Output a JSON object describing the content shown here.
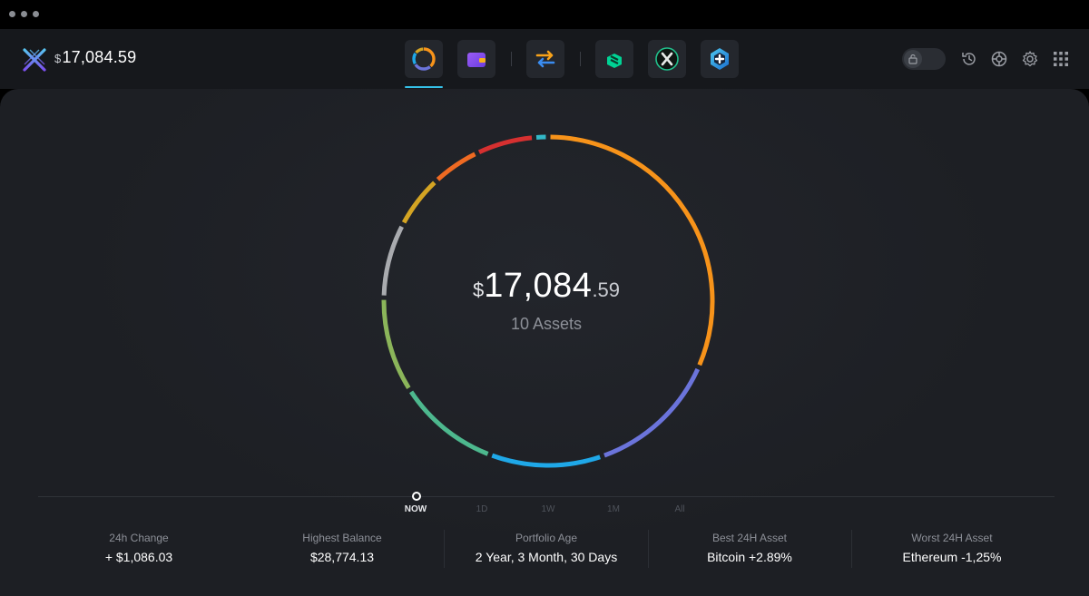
{
  "header": {
    "currency_symbol": "$",
    "balance": "17,084.59",
    "nav": [
      {
        "name": "portfolio",
        "active": true
      },
      {
        "name": "wallet"
      },
      {
        "name": "exchange"
      },
      {
        "name": "compound-app"
      },
      {
        "name": "x-app"
      },
      {
        "name": "add-app"
      }
    ],
    "tools": [
      "lock-toggle",
      "history-icon",
      "help-icon",
      "settings-icon",
      "apps-grid-icon"
    ]
  },
  "portfolio": {
    "currency_symbol": "$",
    "total_int": "17,084",
    "total_dec": ".59",
    "assets_label": "10 Assets",
    "segments": [
      {
        "share": 0.3015,
        "color": "#f7931a"
      },
      {
        "share": 0.125,
        "color": "#6b74db"
      },
      {
        "share": 0.106,
        "color": "#1fa8e8"
      },
      {
        "share": 0.097,
        "color": "#4db88e"
      },
      {
        "share": 0.09,
        "color": "#8bb55a"
      },
      {
        "share": 0.0705,
        "color": "#a9abaf"
      },
      {
        "share": 0.051,
        "color": "#d4a423"
      },
      {
        "share": 0.046,
        "color": "#ef6a22"
      },
      {
        "share": 0.055,
        "color": "#d63030"
      },
      {
        "share": 0.013,
        "color": "#33b8c8"
      }
    ]
  },
  "timeline": {
    "options": [
      "NOW",
      "1D",
      "1W",
      "1M",
      "All"
    ],
    "active": "NOW"
  },
  "stats": [
    {
      "label": "24h Change",
      "value": "+ $1,086.03"
    },
    {
      "label": "Highest Balance",
      "value": "$28,774.13"
    },
    {
      "label": "Portfolio Age",
      "value": "2 Year, 3 Month, 30 Days"
    },
    {
      "label": "Best 24H Asset",
      "value": "Bitcoin +2.89%"
    },
    {
      "label": "Worst 24H Asset",
      "value": "Ethereum -1,25%"
    }
  ]
}
